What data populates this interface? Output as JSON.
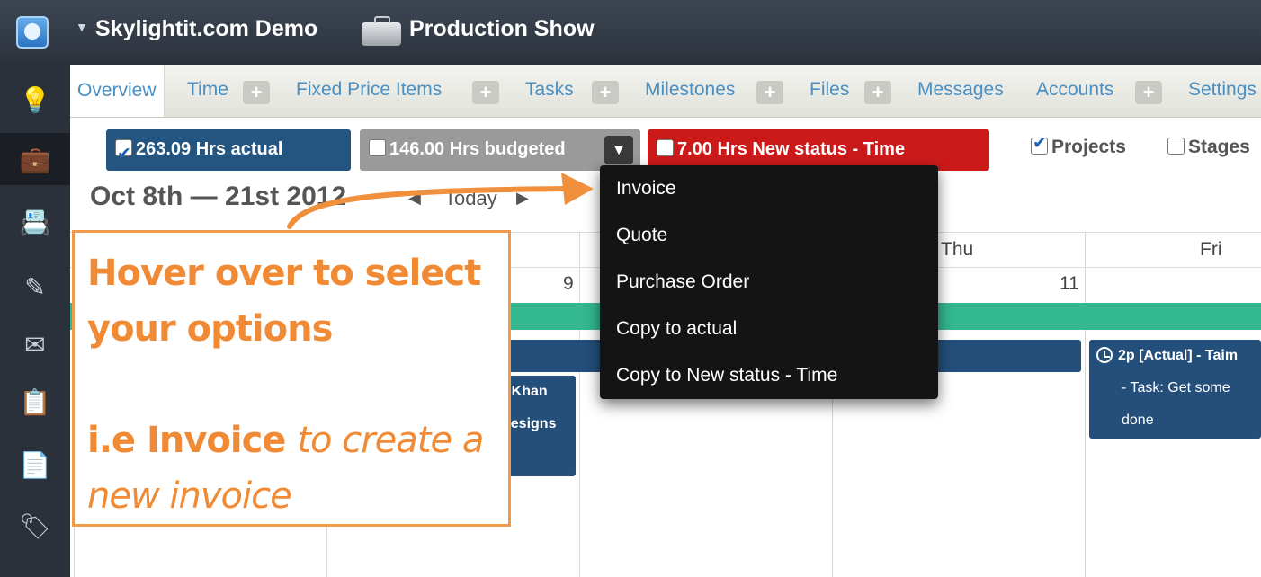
{
  "header": {
    "org_caret": "▼",
    "org_name": "Skylightit.com Demo",
    "project_name": "Production Show"
  },
  "sidebar": {
    "icons": [
      {
        "name": "lightbulb-icon",
        "glyph": "💡"
      },
      {
        "name": "briefcase-icon",
        "glyph": "💼"
      },
      {
        "name": "contacts-icon",
        "glyph": "📇"
      },
      {
        "name": "tools-icon",
        "glyph": "✎"
      },
      {
        "name": "mail-icon",
        "glyph": "✉"
      },
      {
        "name": "clipboard-icon",
        "glyph": "📋"
      },
      {
        "name": "document-icon",
        "glyph": "📄"
      },
      {
        "name": "tag-icon",
        "glyph": "🏷"
      }
    ]
  },
  "tabs": {
    "overview": "Overview",
    "time": "Time",
    "fixed_price": "Fixed Price Items",
    "tasks": "Tasks",
    "milestones": "Milestones",
    "files": "Files",
    "messages": "Messages",
    "accounts": "Accounts",
    "settings": "Settings",
    "plus": "+"
  },
  "summary": {
    "actual": "263.09 Hrs actual",
    "budgeted": "146.00 Hrs budgeted",
    "status": "7.00 Hrs New status - Time",
    "dropdown_glyph": "▼",
    "colors": {
      "actual": "#245580",
      "budgeted": "#9a9a9a",
      "status": "#cc1a1a"
    }
  },
  "filters": {
    "projects": "Projects",
    "stages": "Stages"
  },
  "date_nav": {
    "range": "Oct 8th — 21st 2012",
    "prev": "◀",
    "today": "Today",
    "next": "▶"
  },
  "calendar": {
    "thu": "Thu",
    "fri": "Fri",
    "num_9": "9",
    "num_11": "11",
    "event_partial_1": "r Khan",
    "event_partial_2": "designs",
    "fri_event_line1": "2p [Actual] - Taim",
    "fri_event_line2": "- Task: Get some",
    "fri_event_line3": "done",
    "colors": {
      "green_band": "#33b890",
      "event": "#244f7a"
    }
  },
  "dropdown_menu": {
    "items": [
      "Invoice",
      "Quote",
      "Purchase Order",
      "Copy to actual",
      "Copy to New status - Time"
    ]
  },
  "callout": {
    "line1": "Hover over to select",
    "line2": "your options",
    "line3_bold": "i.e Invoice",
    "line3_italic": "to create a",
    "line4_italic": "new invoice",
    "color": "#f08a34"
  }
}
